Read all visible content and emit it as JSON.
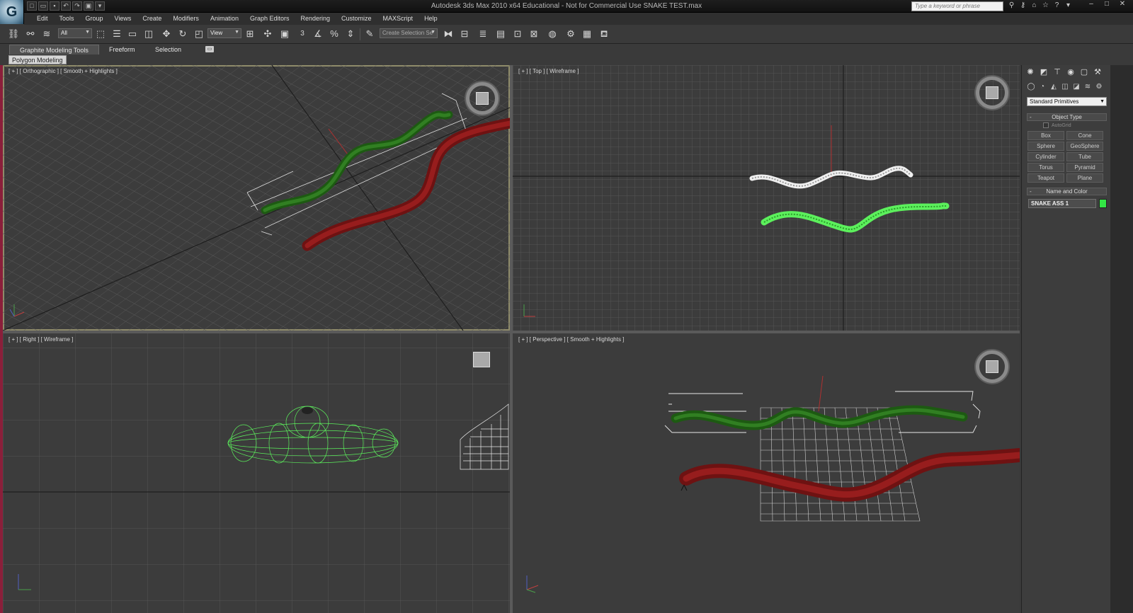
{
  "title_bar": {
    "app_logo": "G",
    "window_title": "Autodesk 3ds Max  2010 x64    Educational  -  Not for Commercial Use      SNAKE TEST.max",
    "search_placeholder": "Type a keyword or phrase",
    "quick_access": [
      "new-icon",
      "open-icon",
      "save-icon",
      "undo-icon",
      "redo-icon",
      "project-icon",
      "dropdown-icon"
    ]
  },
  "menu": {
    "items": [
      "Edit",
      "Tools",
      "Group",
      "Views",
      "Create",
      "Modifiers",
      "Animation",
      "Graph Editors",
      "Rendering",
      "Customize",
      "MAXScript",
      "Help"
    ]
  },
  "toolbar": {
    "selection_filter": "All",
    "reference_coord": "View",
    "named_selection_placeholder": "Create Selection Se",
    "snap_label": "3"
  },
  "ribbon": {
    "tabs": [
      "Graphite Modeling Tools",
      "Freeform",
      "Selection"
    ],
    "active_tab": "Graphite Modeling Tools",
    "panel_label": "Polygon Modeling"
  },
  "viewports": {
    "top_left": {
      "label": "[ + ] [ Orthographic ] [ Smooth + Highlights ]"
    },
    "top_right": {
      "label": "[ + ] [ Top ] [ Wireframe ]"
    },
    "bottom_left": {
      "label": "[ + ] [ Right ] [ Wireframe ]"
    },
    "bottom_right": {
      "label": "[ + ] [ Perspective ] [ Smooth + Highlights ]"
    }
  },
  "command_panel": {
    "tabs": [
      "create-icon",
      "modify-icon",
      "hierarchy-icon",
      "motion-icon",
      "display-icon",
      "utilities-icon"
    ],
    "category_select": "Standard Primitives",
    "object_type": {
      "title": "Object Type",
      "autogrid_label": "AutoGrid",
      "buttons": [
        "Box",
        "Cone",
        "Sphere",
        "GeoSphere",
        "Cylinder",
        "Tube",
        "Torus",
        "Pyramid",
        "Teapot",
        "Plane"
      ]
    },
    "name_and_color": {
      "title": "Name and Color",
      "object_name": "SNAKE ASS 1",
      "color": "#33e645"
    }
  },
  "colors": {
    "green_snake": "#2e7d1f",
    "red_snake": "#8b1a1a",
    "selected_wire": "#5cf05c",
    "grid_line": "#5a5a5a"
  }
}
